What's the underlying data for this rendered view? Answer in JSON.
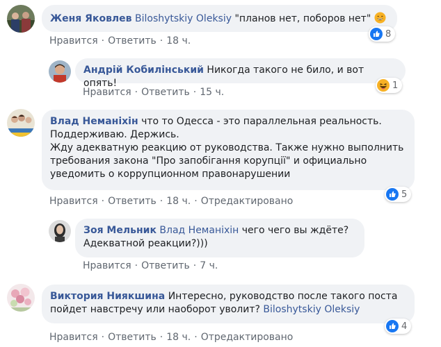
{
  "comments": [
    {
      "author": "Женя Яковлев",
      "mention": "Biloshytskiy Oleksiy",
      "text": " \"планов нет, поборов нет\" ",
      "like": "Нравится",
      "reply": "Ответить",
      "time": "18 ч.",
      "edited": "",
      "reaction_icon": "laugh-icon like-icon",
      "reaction_count": "8"
    },
    {
      "author": "Андрій Кобилінський",
      "mention": "",
      "text": "Никогда такого не било, и вот опять!",
      "like": "Нравится",
      "reply": "Ответить",
      "time": "15 ч.",
      "edited": "",
      "reaction_icon": "laugh-icon",
      "reaction_count": "1"
    },
    {
      "author": "Влад Неманіхін",
      "mention": "",
      "text_lines": [
        "что то Одесса - это параллельная реальность.",
        "Поддерживаю. Держись.",
        "Жду адекватную реакцию от руководства. Также нужно выполнить",
        "требования закона \"Про запобігання корупції\" и официально",
        "уведомить о коррупционном правонарушении"
      ],
      "like": "Нравится",
      "reply": "Ответить",
      "time": "18 ч.",
      "edited": "Отредактировано",
      "reaction_icon": "like-icon",
      "reaction_count": "5"
    },
    {
      "author": "Зоя Мельник",
      "mention": "Влад Неманіхін",
      "text_lines": [
        "чего чего вы ждёте?",
        "Адекватной реакции?)))"
      ],
      "like": "Нравится",
      "reply": "Ответить",
      "time": "7 ч.",
      "edited": ""
    },
    {
      "author": "Виктория Ниякшина",
      "mention": "Biloshytskiy Oleksiy",
      "text_lines": [
        "Интересно, руководство после такого поста",
        "пойдет навстречу или наоборот уволит?"
      ],
      "like": "Нравится",
      "reply": "Ответить",
      "time": "18 ч.",
      "edited": "Отредактировано",
      "reaction_icon": "like-icon",
      "reaction_count": "4"
    }
  ],
  "separator": "·",
  "colors": {
    "link": "#385898",
    "bubble": "#f0f2f5",
    "meta": "#606770",
    "like_blue": "#1877f2",
    "laugh_yellow": "#f7b125"
  }
}
